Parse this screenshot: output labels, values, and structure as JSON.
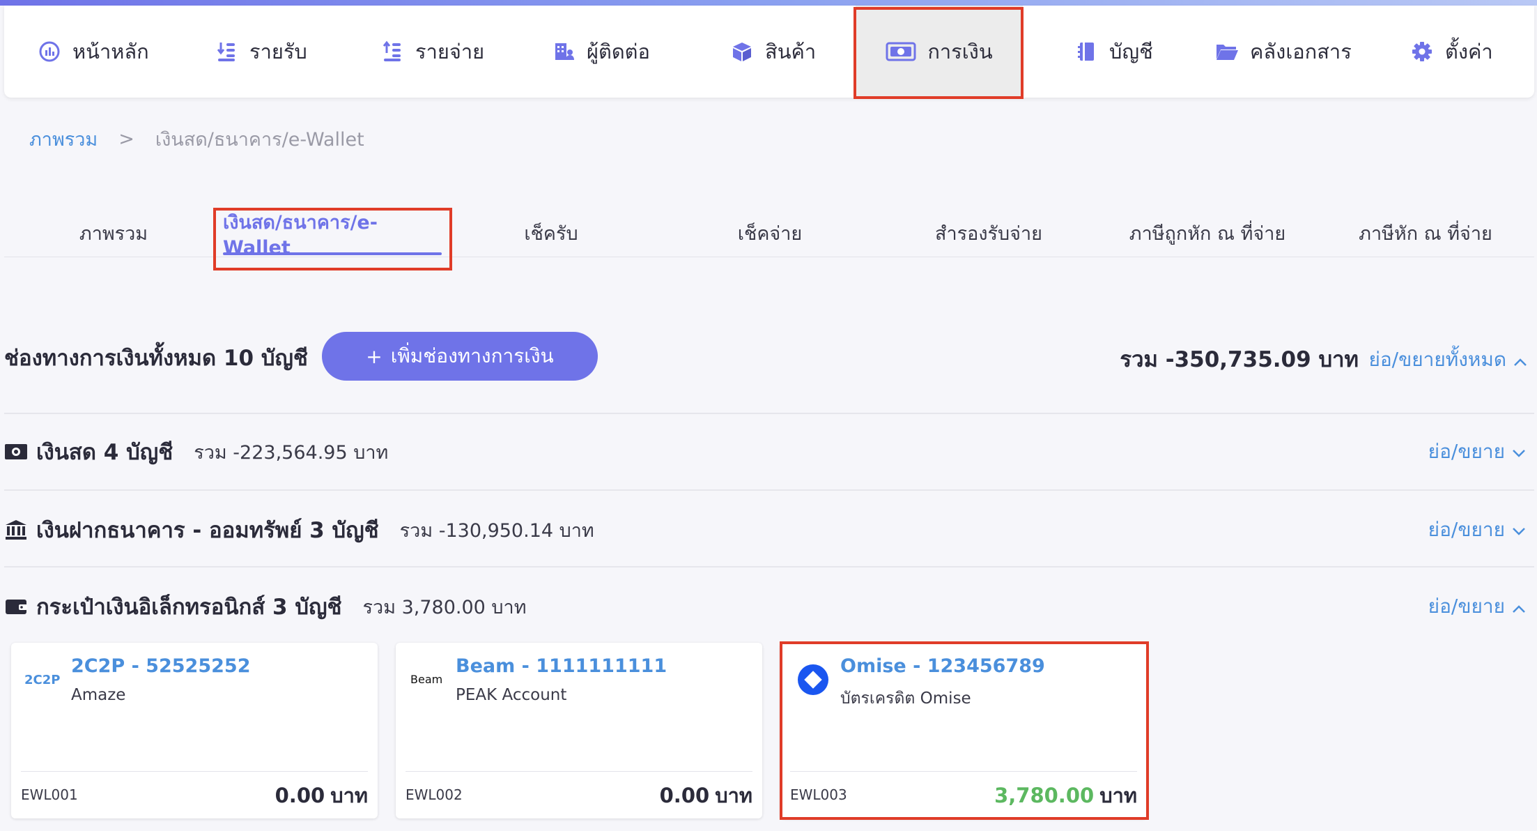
{
  "nav": {
    "items": [
      {
        "label": "หน้าหลัก",
        "icon": "dashboard-icon"
      },
      {
        "label": "รายรับ",
        "icon": "income-icon"
      },
      {
        "label": "รายจ่าย",
        "icon": "expense-icon"
      },
      {
        "label": "ผู้ติดต่อ",
        "icon": "contacts-icon"
      },
      {
        "label": "สินค้า",
        "icon": "box-icon"
      },
      {
        "label": "การเงิน",
        "icon": "money-icon"
      },
      {
        "label": "บัญชี",
        "icon": "ledger-icon"
      },
      {
        "label": "คลังเอกสาร",
        "icon": "folder-icon"
      },
      {
        "label": "ตั้งค่า",
        "icon": "gear-icon"
      }
    ],
    "active": "การเงิน"
  },
  "breadcrumb": {
    "root": "ภาพรวม",
    "separator": ">",
    "current": "เงินสด/ธนาคาร/e-Wallet"
  },
  "tabs": [
    {
      "label": "ภาพรวม"
    },
    {
      "label": "เงินสด/ธนาคาร/e-Wallet"
    },
    {
      "label": "เช็ครับ"
    },
    {
      "label": "เช็คจ่าย"
    },
    {
      "label": "สำรองรับจ่าย"
    },
    {
      "label": "ภาษีถูกหัก ณ ที่จ่าย"
    },
    {
      "label": "ภาษีหัก ณ ที่จ่าย"
    }
  ],
  "summary": {
    "title": "ช่องทางการเงินทั้งหมด 10 บัญชี",
    "add_button": "เพิ่มช่องทางการเงิน",
    "add_button_plus": "+",
    "total": "รวม -350,735.09 บาท",
    "collapse_all": "ย่อ/ขยายทั้งหมด"
  },
  "groups": {
    "cash": {
      "title": "เงินสด 4 บัญชี",
      "sum": "รวม -223,564.95 บาท",
      "toggle": "ย่อ/ขยาย"
    },
    "bank": {
      "title": "เงินฝากธนาคาร - ออมทรัพย์ 3 บัญชี",
      "sum": "รวม -130,950.14 บาท",
      "toggle": "ย่อ/ขยาย"
    },
    "ewallet": {
      "title": "กระเป๋าเงินอิเล็กทรอนิกส์ 3 บัญชี",
      "sum": "รวม 3,780.00 บาท",
      "toggle": "ย่อ/ขยาย"
    }
  },
  "cards": [
    {
      "name": "2C2P - 52525252",
      "sub": "Amaze",
      "code": "EWL001",
      "amount": "0.00",
      "unit": "บาท",
      "logo_text": "2C2P"
    },
    {
      "name": "Beam - 1111111111",
      "sub": "PEAK Account",
      "code": "EWL002",
      "amount": "0.00",
      "unit": "บาท",
      "logo_text": "Beam"
    },
    {
      "name": "Omise - 123456789",
      "sub": "บัตรเครดิต Omise",
      "code": "EWL003",
      "amount": "3,780.00",
      "unit": "บาท"
    }
  ],
  "colors": {
    "accent": "#6f73e8",
    "link": "#4a8fdc",
    "highlight": "#e03c28",
    "positive": "#5cb860"
  }
}
